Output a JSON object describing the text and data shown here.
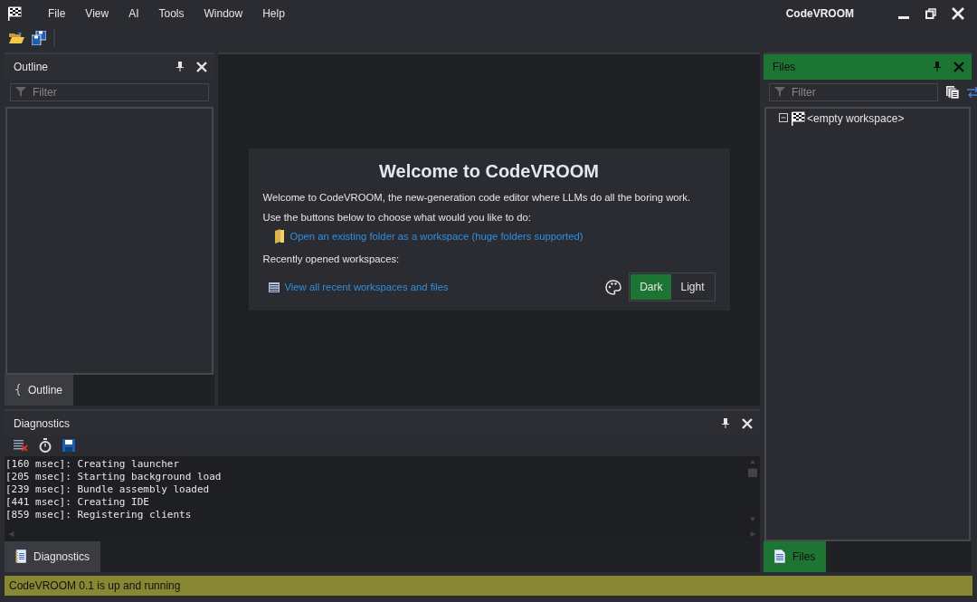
{
  "window": {
    "title": "CodeVROOM"
  },
  "menu": [
    "File",
    "View",
    "AI",
    "Tools",
    "Window",
    "Help"
  ],
  "outline": {
    "title": "Outline",
    "active": false,
    "filter": {
      "placeholder": "Filter"
    },
    "tab": {
      "label": "Outline",
      "selected": true
    }
  },
  "welcome": {
    "heading": "Welcome to CodeVROOM",
    "intro": "Welcome to CodeVROOM, the new-generation code editor where LLMs do all the boring work.",
    "prompt": "Use the buttons below to choose what would you like to do:",
    "open_link": "Open an existing folder as a workspace (huge folders supported)",
    "recent_label": "Recently opened workspaces:",
    "recent_link": "View all recent workspaces and files",
    "themes": [
      {
        "label": "Dark",
        "selected": true
      },
      {
        "label": "Light",
        "selected": false
      }
    ]
  },
  "files": {
    "title": "Files",
    "active": true,
    "filter": {
      "placeholder": "Filter"
    },
    "tree": [
      {
        "label": "<empty workspace>",
        "expanded": true
      }
    ],
    "tab": {
      "label": "Files",
      "selected": true
    }
  },
  "diagnostics": {
    "title": "Diagnostics",
    "active": false,
    "log": [
      "[160 msec]: Creating launcher",
      "[205 msec]: Starting background load",
      "[239 msec]: Bundle assembly loaded",
      "[441 msec]: Creating IDE",
      "[859 msec]: Registering clients"
    ],
    "tab": {
      "label": "Diagnostics",
      "selected": true
    }
  },
  "status_bar": {
    "text": "CodeVROOM 0.1 is up and running"
  }
}
